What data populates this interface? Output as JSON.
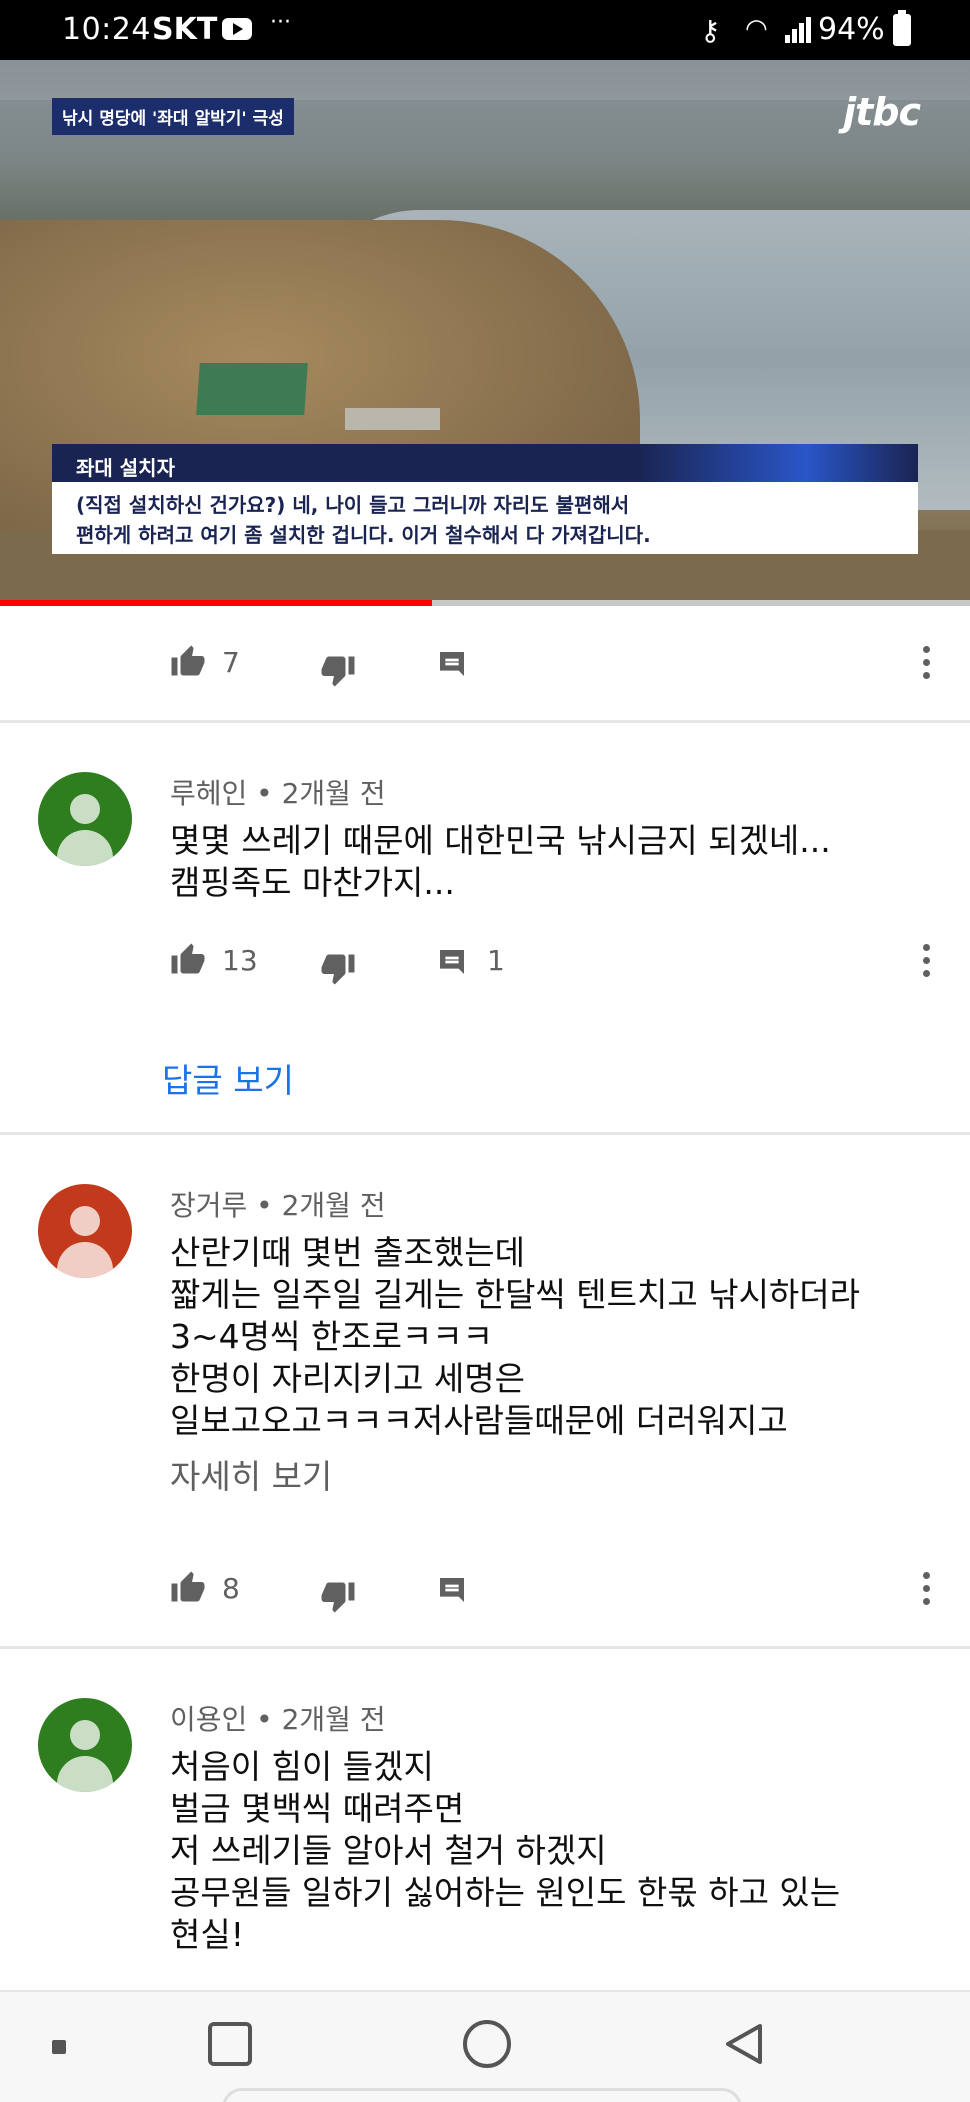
{
  "status_bar": {
    "time": "10:24",
    "carrier": "SKT",
    "more": "···",
    "battery": "94%"
  },
  "video": {
    "headline_tag": "낚시 명당에 '좌대 알박기' 극성",
    "logo": "jtbc",
    "caption_label": "좌대 설치자",
    "caption_line1": "(직접 설치하신 건가요?) 네, 나이 들고 그러니까 자리도 불편해서",
    "caption_line2": "편하게 하려고 여기 좀 설치한 겁니다. 이거 철수해서 다 가져갑니다.",
    "progress": 0.445
  },
  "video_actions": {
    "like_count": "7"
  },
  "comments": [
    {
      "author": "루헤인",
      "time": "2개월 전",
      "avatar_color": "#2e7d1e",
      "body": "몇몇 쓰레기 때문에 대한민국 낚시금지 되겠네...\n캠핑족도 마찬가지...",
      "like_count": "13",
      "reply_count": "1",
      "view_replies": "답글 보기"
    },
    {
      "author": "장거루",
      "time": "2개월 전",
      "avatar_color": "#c2391b",
      "body": "산란기때 몇번 출조했는데\n짧게는 일주일 길게는 한달씩 텐트치고 낚시하더라\n3~4명씩 한조로ㅋㅋㅋ\n한명이 자리지키고 세명은\n일보고오고ㅋㅋㅋ저사람들때문에 더러워지고",
      "read_more": "자세히 보기",
      "like_count": "8"
    },
    {
      "author": "이용인",
      "time": "2개월 전",
      "avatar_color": "#2e7d1e",
      "body": "처음이 힘이 들겠지\n벌금 몇백씩 때려주면\n저 쓰레기들 알아서 철거 하겠지\n공무원들 일하기 싫어하는 원인도 한몫 하고 있는\n현실!"
    }
  ],
  "colors": {
    "accent_link": "#1a73e8",
    "progress_red": "#ff0000",
    "caption_navy": "#1a2452"
  },
  "icons": {
    "like": "thumb-up-icon",
    "dislike": "thumb-down-icon",
    "reply": "comment-icon",
    "more": "more-vert-icon"
  }
}
